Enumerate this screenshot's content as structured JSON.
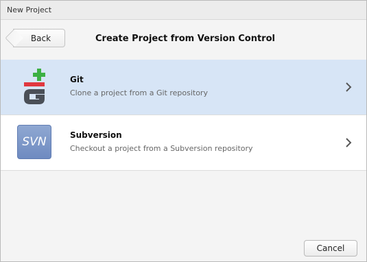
{
  "window": {
    "title": "New Project"
  },
  "header": {
    "back_label": "Back",
    "title": "Create Project from Version Control"
  },
  "options": [
    {
      "title": "Git",
      "description": "Clone a project from a Git repository",
      "icon": "git-icon",
      "selected": true
    },
    {
      "title": "Subversion",
      "description": "Checkout a project from a Subversion repository",
      "icon": "svn-icon",
      "icon_text": "SVN",
      "selected": false
    }
  ],
  "footer": {
    "cancel_label": "Cancel"
  },
  "colors": {
    "selected_row": "#d7e5f6",
    "git_green": "#3cb043",
    "git_red": "#e0383f",
    "git_grey": "#4a4f57",
    "svn_blue": "#7b96c9"
  }
}
